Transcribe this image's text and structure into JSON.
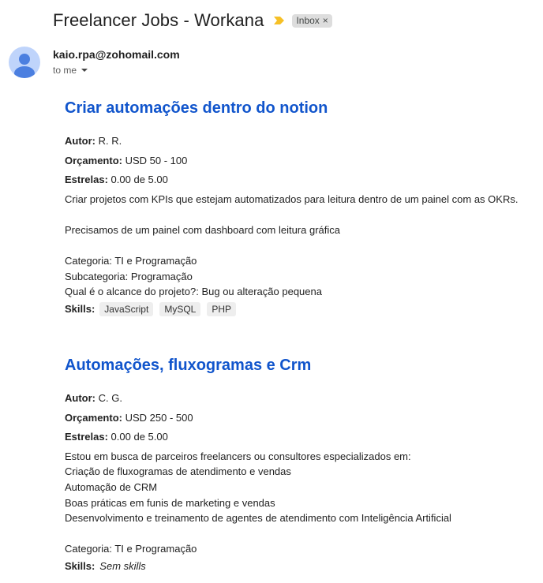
{
  "email": {
    "subject": "Freelancer Jobs - Workana",
    "label": "Inbox",
    "label_remove": "×",
    "sender": "kaio.rpa@zohomail.com",
    "recipient": "to me"
  },
  "jobs": [
    {
      "title": "Criar automações dentro do notion",
      "author_label": "Autor:",
      "author": "R. R.",
      "budget_label": "Orçamento:",
      "budget": "USD 50 - 100",
      "stars_label": "Estrelas:",
      "stars": "0.00 de 5.00",
      "description": [
        "Criar projetos com KPIs que estejam automatizados para leitura dentro de um painel com as OKRs.",
        "",
        "Precisamos de um painel com dashboard com leitura gráfica",
        "",
        "Categoria: TI e Programação",
        "Subcategoria: Programação",
        "Qual é o alcance do projeto?: Bug ou alteração pequena"
      ],
      "skills_label": "Skills:",
      "skills": [
        "JavaScript",
        "MySQL",
        "PHP"
      ]
    },
    {
      "title": "Automações, fluxogramas e Crm",
      "author_label": "Autor:",
      "author": "C. G.",
      "budget_label": "Orçamento:",
      "budget": "USD 250 - 500",
      "stars_label": "Estrelas:",
      "stars": "0.00 de 5.00",
      "description": [
        "Estou em busca de parceiros freelancers ou consultores especializados em:",
        "Criação de fluxogramas de atendimento e vendas",
        "Automação de CRM",
        "Boas práticas em funis de marketing e vendas",
        "Desenvolvimento e treinamento de agentes de atendimento com Inteligência Artificial",
        "",
        "Categoria: TI e Programação"
      ],
      "skills_label": "Skills:",
      "no_skills": "Sem skills"
    }
  ]
}
